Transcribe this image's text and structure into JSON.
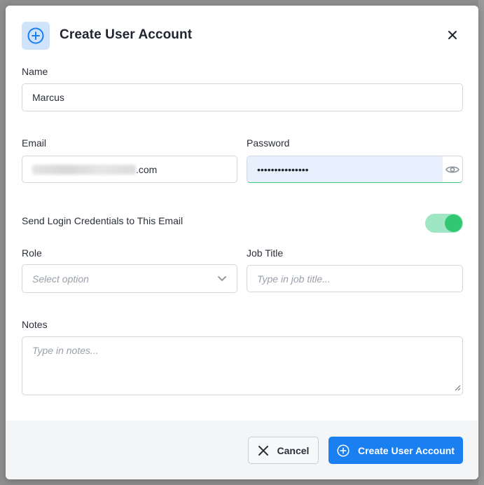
{
  "dialog": {
    "title": "Create User Account",
    "close_icon": "close-icon",
    "header_icon": "plus-circle-icon"
  },
  "form": {
    "name": {
      "label": "Name",
      "value": "Marcus"
    },
    "email": {
      "label": "Email",
      "value_suffix": ".com"
    },
    "password": {
      "label": "Password",
      "value": "•••••••••••••••",
      "reveal_icon": "eye-icon"
    },
    "send_credentials": {
      "label": "Send Login Credentials to This Email",
      "enabled": true
    },
    "role": {
      "label": "Role",
      "placeholder": "Select option"
    },
    "job_title": {
      "label": "Job Title",
      "placeholder": "Type in job title..."
    },
    "notes": {
      "label": "Notes",
      "placeholder": "Type in notes..."
    }
  },
  "footer": {
    "cancel_label": "Cancel",
    "create_label": "Create User Account"
  },
  "colors": {
    "primary": "#1a7ff0",
    "toggle_on": "#32c872",
    "toggle_track": "#9fe6c4",
    "header_icon_bg": "#cfe3fb"
  }
}
